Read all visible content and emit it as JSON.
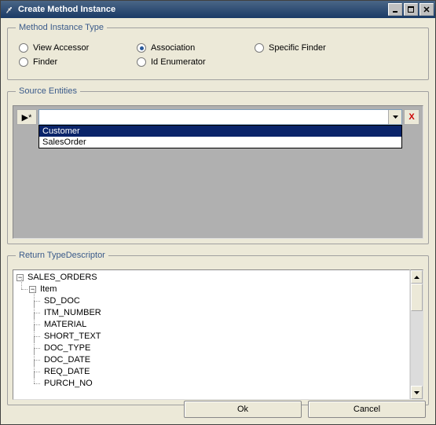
{
  "window": {
    "title": "Create Method Instance"
  },
  "method_instance_type": {
    "legend": "Method Instance Type",
    "options": [
      {
        "label": "View Accessor",
        "checked": false
      },
      {
        "label": "Association",
        "checked": true
      },
      {
        "label": "Specific Finder",
        "checked": false
      },
      {
        "label": "Finder",
        "checked": false
      },
      {
        "label": "Id Enumerator",
        "checked": false
      }
    ]
  },
  "source_entities": {
    "legend": "Source Entities",
    "row_indicator": "▶*",
    "selected_value": "",
    "delete_glyph": "X",
    "options": [
      {
        "label": "Customer",
        "selected": true
      },
      {
        "label": "SalesOrder",
        "selected": false
      }
    ]
  },
  "return_type_descriptor": {
    "legend": "Return TypeDescriptor",
    "root": {
      "label": "SALES_ORDERS",
      "expanded": true,
      "children": [
        {
          "label": "Item",
          "expanded": true,
          "children": [
            {
              "label": "SD_DOC"
            },
            {
              "label": "ITM_NUMBER"
            },
            {
              "label": "MATERIAL"
            },
            {
              "label": "SHORT_TEXT"
            },
            {
              "label": "DOC_TYPE"
            },
            {
              "label": "DOC_DATE"
            },
            {
              "label": "REQ_DATE"
            },
            {
              "label": "PURCH_NO"
            }
          ]
        }
      ]
    }
  },
  "buttons": {
    "ok": "Ok",
    "cancel": "Cancel"
  }
}
